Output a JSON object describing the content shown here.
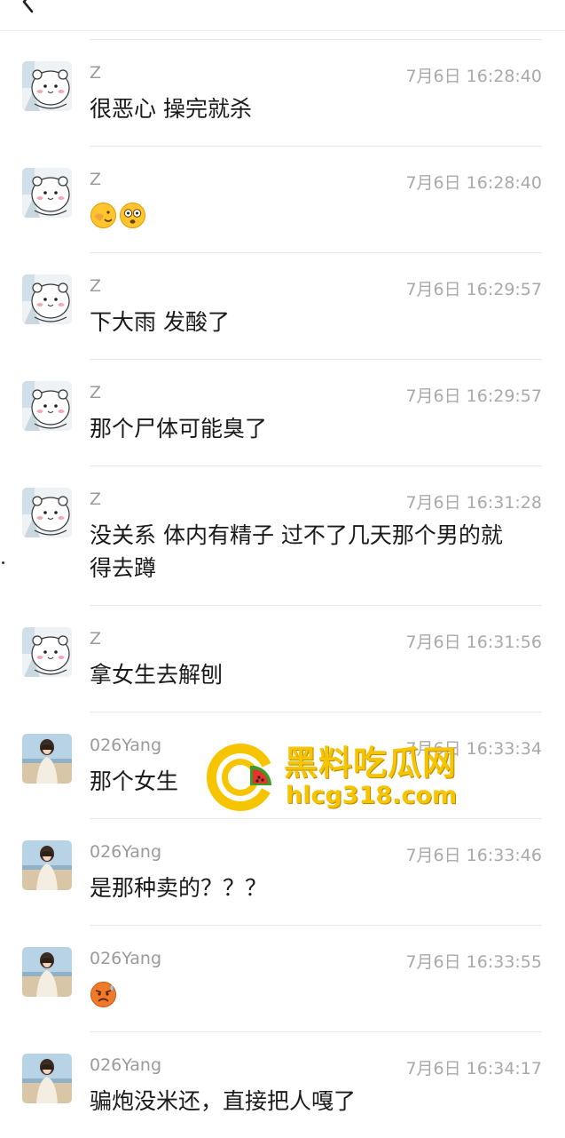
{
  "header": {
    "back_icon": "chevron-left-icon"
  },
  "messages": [
    {
      "sender": "Z",
      "time": "7月6日 16:28:40",
      "text": "很恶心 操完就杀",
      "avatar": "white-bear-sticker"
    },
    {
      "sender": "Z",
      "time": "7月6日 16:28:40",
      "text": "",
      "emojis": [
        "facepalm-emoji",
        "shocked-emoji"
      ],
      "avatar": "white-bear-sticker"
    },
    {
      "sender": "Z",
      "time": "7月6日 16:29:57",
      "text": "下大雨 发酸了",
      "avatar": "white-bear-sticker"
    },
    {
      "sender": "Z",
      "time": "7月6日 16:29:57",
      "text": "那个尸体可能臭了",
      "avatar": "white-bear-sticker"
    },
    {
      "sender": "Z",
      "time": "7月6日 16:31:28",
      "text": "没关系 体内有精子 过不了几天那个男的就\n得去蹲",
      "avatar": "white-bear-sticker"
    },
    {
      "sender": "Z",
      "time": "7月6日 16:31:56",
      "text": "拿女生去解刨",
      "avatar": "white-bear-sticker"
    },
    {
      "sender": "026Yang",
      "time": "7月6日 16:33:34",
      "text": "那个女生",
      "avatar": "girl-photo"
    },
    {
      "sender": "026Yang",
      "time": "7月6日 16:33:46",
      "text": "是那种卖的？？？",
      "avatar": "girl-photo"
    },
    {
      "sender": "026Yang",
      "time": "7月6日 16:33:55",
      "text": "",
      "emojis": [
        "sweat-emoji"
      ],
      "avatar": "girl-photo"
    },
    {
      "sender": "026Yang",
      "time": "7月6日 16:34:17",
      "text": "骗炮没米还，直接把人嘎了",
      "avatar": "girl-photo"
    }
  ],
  "watermark": {
    "title": "黑料吃瓜网",
    "url": "hlcg318.com",
    "logo": "watermelon-logo-icon",
    "accent_color": "#f7c400"
  }
}
